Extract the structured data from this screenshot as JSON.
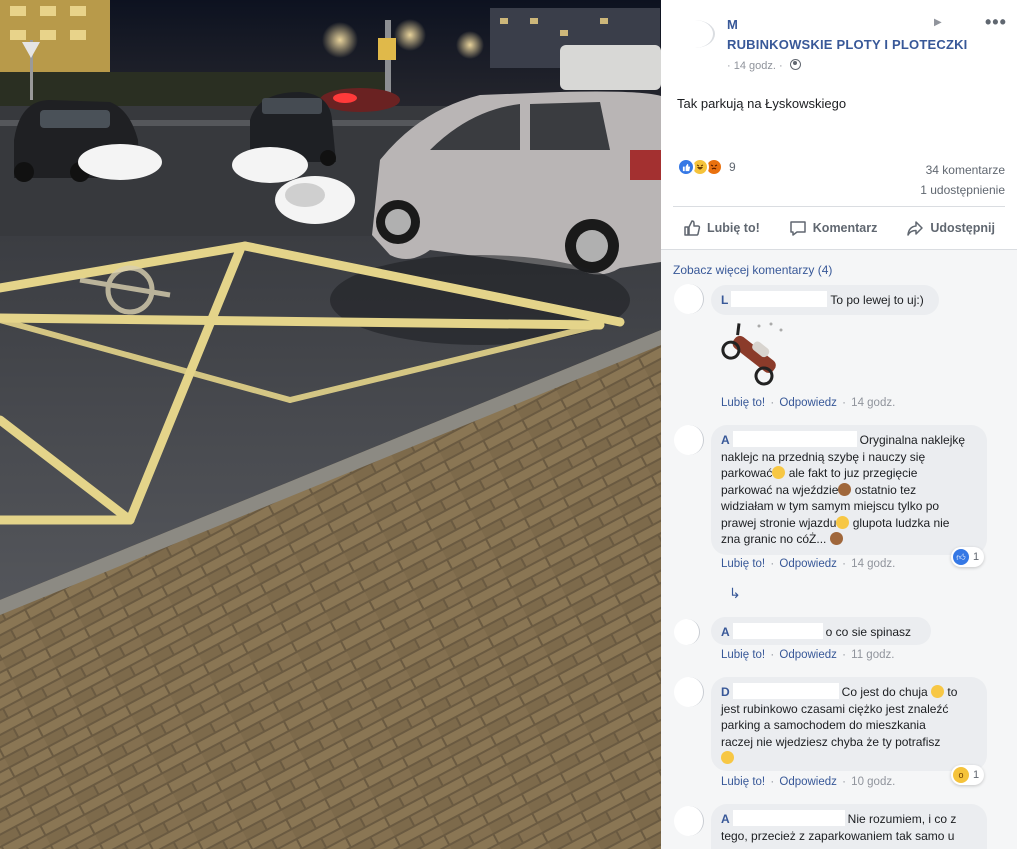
{
  "photo": {
    "description_icon": "photo-parking-icon"
  },
  "post": {
    "poster_initial": "M",
    "group_name": "RUBINKOWSKIE PLOTY I PLOTECZKI",
    "timestamp": "14 godz.",
    "privacy_icon": "globe-icon",
    "text": "Tak parkują na Łyskowskiego",
    "reactions": {
      "icons": [
        "like-icon",
        "haha-icon",
        "angry-icon"
      ],
      "count": "9"
    },
    "comments_count": "34 komentarze",
    "shares_count": "1 udostępnienie"
  },
  "actions": {
    "like": "Lubię to!",
    "comment": "Komentarz",
    "share": "Udostępnij"
  },
  "comments_section": {
    "more_label": "Zobacz więcej komentarzy (4)",
    "like_label": "Lubię to!",
    "reply_label": "Odpowiedz",
    "items": [
      {
        "author_initial": "L",
        "text": "To po lewej to uj:)",
        "time": "14 godz."
      },
      {
        "author_initial": "A",
        "text_1": "Oryginalna naklejkę",
        "text_2": "naklejc na przednią szybę i nauczy się",
        "text_3": "parkować",
        "text_4": "ale fakt to juz przegięcie",
        "text_5": "parkować na wjeździe",
        "text_6": "ostatnio tez",
        "text_7": "widziałam w tym samym miejscu tylko po",
        "text_8": "prawej stronie wjazdu",
        "text_9": "glupota ludzka nie",
        "text_10": "zna granic no cóŻ...",
        "time": "14 godz.",
        "reaction_count": "1"
      },
      {
        "author_initial": "A",
        "text": "o co sie spinasz",
        "time": "11 godz."
      },
      {
        "author_initial": "D",
        "text_1": "Co jest do chuja",
        "text_2": "to",
        "text_3": "jest rubinkowo czasami ciężko jest znaleźć",
        "text_4": "parking a samochodem do mieszkania",
        "text_5": "raczej nie wjedziesz chyba że ty potrafisz",
        "time": "10 godz.",
        "reaction_count": "1"
      },
      {
        "author_initial": "A",
        "text_1": "Nie rozumiem, i co z",
        "text_2": "tego, przecież z zaparkowaniem tak samo u"
      }
    ]
  }
}
